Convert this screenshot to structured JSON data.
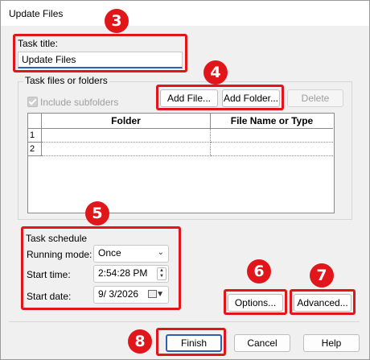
{
  "window": {
    "title": "Update Files"
  },
  "task_title": {
    "label": "Task title:",
    "value": "Update Files"
  },
  "files": {
    "group_label": "Task files or folders",
    "include_subfolders_label": "Include subfolders",
    "add_file_label": "Add File...",
    "add_folder_label": "Add Folder...",
    "delete_label": "Delete",
    "columns": [
      "Folder",
      "File Name or Type"
    ],
    "rows": [
      "1",
      "2"
    ]
  },
  "schedule": {
    "group_label": "Task schedule",
    "running_mode_label": "Running mode:",
    "running_mode_value": "Once",
    "start_time_label": "Start time:",
    "start_time_value": "2:54:28 PM",
    "start_date_label": "Start date:",
    "start_date_value": "9/ 3/2026"
  },
  "buttons": {
    "options": "Options...",
    "advanced": "Advanced...",
    "finish": "Finish",
    "cancel": "Cancel",
    "help": "Help"
  },
  "annotations": [
    "3",
    "4",
    "5",
    "6",
    "7",
    "8"
  ],
  "colors": {
    "highlight": "#e0161a",
    "focus": "#2b5fb8"
  }
}
